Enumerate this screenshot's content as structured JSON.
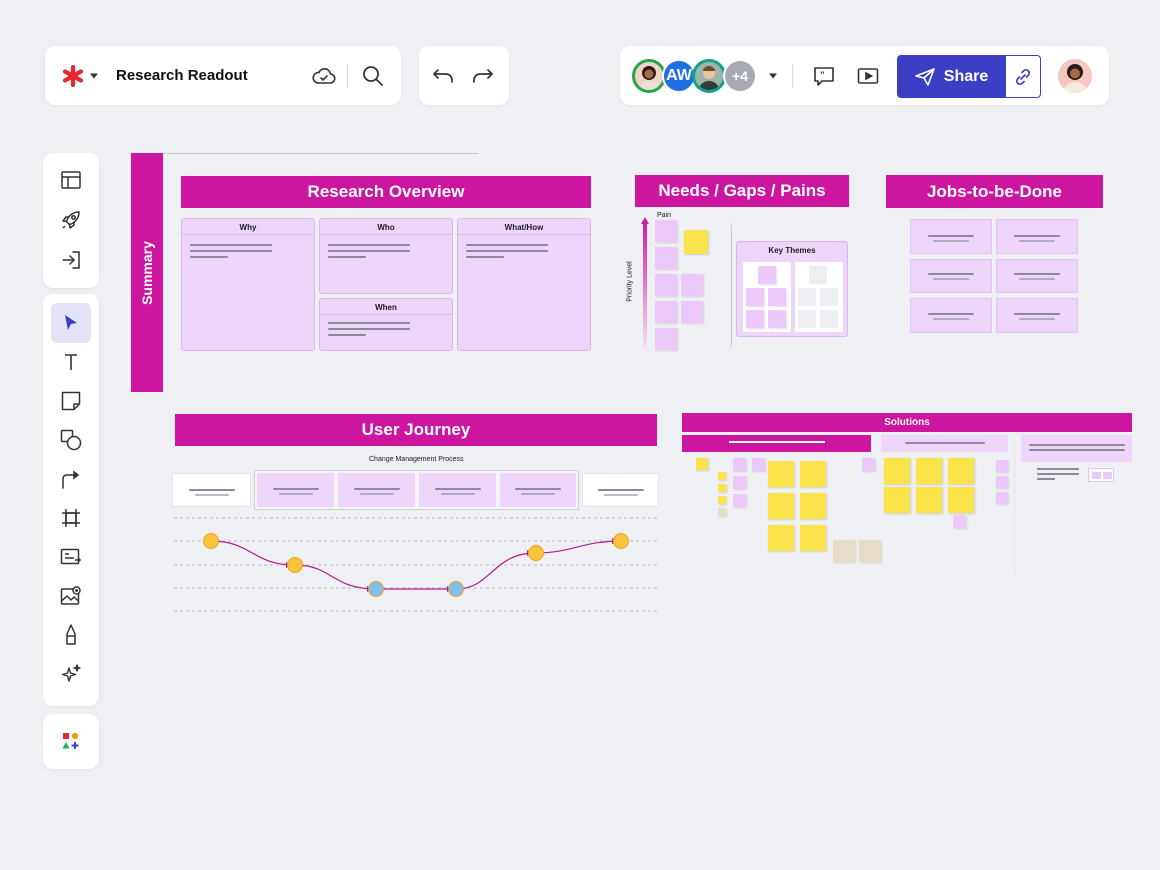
{
  "app": {
    "doc_title": "Research Readout"
  },
  "toolbar": {
    "collaborator_initials": "AW",
    "more_collaborators": "+4",
    "share_label": "Share"
  },
  "sections": {
    "summary": "Summary",
    "research_overview": {
      "title": "Research Overview",
      "cards": [
        "Why",
        "Who",
        "What/How",
        "When"
      ]
    },
    "needs": {
      "title": "Needs / Gaps / Pains",
      "axis_top": "Pain",
      "axis_label": "Priority Level",
      "key_themes": "Key Themes"
    },
    "jtbd": {
      "title": "Jobs-to-be-Done"
    },
    "journey": {
      "title": "User Journey",
      "process_label": "Change Management Process"
    },
    "solutions": {
      "title": "Solutions"
    }
  },
  "colors": {
    "accent_magenta": "#cc169f",
    "lilac": "#eed5fb",
    "sticky_yellow": "#fbe34b",
    "share_blue": "#3b3fc4"
  },
  "icons": {
    "logo": "asterisk-logo",
    "cloud": "cloud-sync-icon",
    "search": "search-icon",
    "undo": "undo-icon",
    "redo": "redo-icon",
    "comments": "comment-icon",
    "present": "present-icon",
    "link": "link-icon",
    "tools": [
      "layout-icon",
      "rocket-icon",
      "import-icon",
      "select-cursor-icon",
      "text-icon",
      "sticky-note-icon",
      "shapes-icon",
      "connector-icon",
      "frame-icon",
      "card-icon",
      "image-icon",
      "pen-icon",
      "ai-sparkle-icon",
      "more-shapes-icon"
    ]
  }
}
